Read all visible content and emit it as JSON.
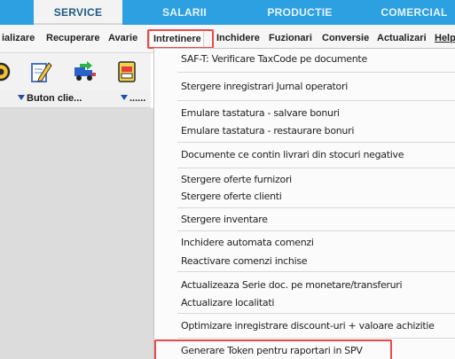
{
  "tabs": [
    {
      "label": "SERVICE",
      "active": true
    },
    {
      "label": "SALARII"
    },
    {
      "label": "PRODUCTIE"
    },
    {
      "label": "COMERCIAL"
    }
  ],
  "menubar": {
    "items": [
      "ializare",
      "Recuperare",
      "Avarie",
      "Intretinere",
      "Inchidere",
      "Fuzionari",
      "Conversie",
      "Actualizari",
      "Help"
    ],
    "open_item": "Intretinere"
  },
  "toolbar": {
    "icons": [
      "partial-circle-icon",
      "edit-document-icon",
      "transfer-truck-icon",
      "calendar-icon"
    ]
  },
  "columns": {
    "col1": "Buton clie...",
    "col2": "......"
  },
  "dropdown": {
    "items": [
      "SAF-T: Verificare TaxCode pe documente",
      "Stergere inregistrari Jurnal operatori",
      "Emulare tastatura - salvare bonuri",
      "Emulare tastatura - restaurare bonuri",
      "Documente ce contin livrari din stocuri negative",
      "Stergere oferte furnizori",
      "Stergere oferte clienti",
      "Stergere inventare",
      "Inchidere automata comenzi",
      "Reactivare comenzi inchise",
      "Actualizeaza Serie doc. pe monetare/transferuri",
      "Actualizare localitati",
      "Optimizare inregistrare discount-uri + valoare achizitie",
      "Generare Token pentru raportari in SPV"
    ]
  },
  "colors": {
    "tab_bar": "#2da0e2",
    "highlight_box": "#e84a4a"
  }
}
